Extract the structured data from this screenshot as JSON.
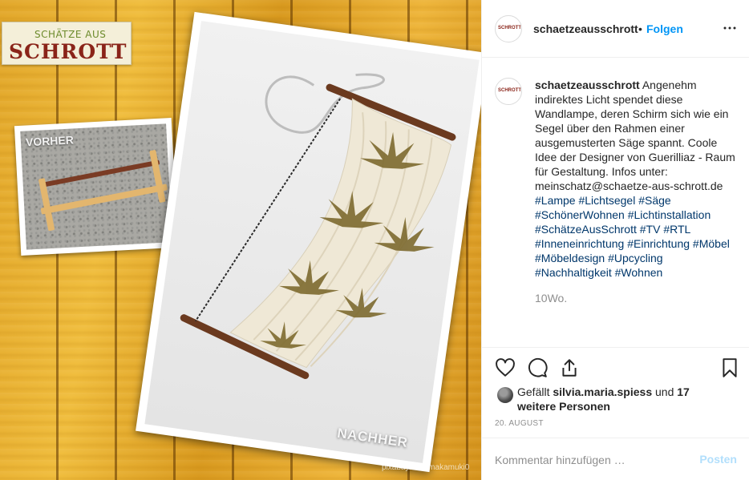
{
  "post_image": {
    "logo": {
      "line1": "SCHÄTZE AUS",
      "line2": "SCHROTT"
    },
    "before_label": "VORHER",
    "after_label": "NACHHER",
    "watermark": "pixabay.com makamuki0"
  },
  "header": {
    "username": "schaetzeausschrott",
    "separator": "•",
    "follow_label": "Folgen",
    "more_icon": "more-horizontal-icon"
  },
  "caption": {
    "username": "schaetzeausschrott",
    "text": "Angenehm indirektes Licht spendet diese Wandlampe, deren Schirm sich wie ein Segel über den Rahmen einer ausgemusterten Säge spannt. Coole Idee der Designer von Guerilliaz - Raum für Gestaltung. Infos unter: meinschatz@schaetze-aus-schrott.de",
    "hashtags": [
      "#Lampe",
      "#Lichtsegel",
      "#Säge",
      "#SchönerWohnen",
      "#Lichtinstallation",
      "#SchätzeAusSchrott",
      "#TV",
      "#RTL",
      "#Inneneinrichtung",
      "#Einrichtung",
      "#Möbel",
      "#Möbeldesign",
      "#Upcycling",
      "#Nachhaltigkeit",
      "#Wohnen"
    ],
    "age": "10Wo."
  },
  "actions": {
    "icons": [
      "heart-icon",
      "comment-icon",
      "share-icon",
      "bookmark-icon"
    ]
  },
  "likes": {
    "prefix": "Gefällt",
    "user": "silvia.maria.spiess",
    "connector": "und",
    "others": "17 weitere Personen"
  },
  "date": "20. AUGUST",
  "comment_box": {
    "placeholder": "Kommentar hinzufügen …",
    "post_label": "Posten"
  },
  "colors": {
    "link_blue": "#0095f6",
    "hashtag_blue": "#00376b",
    "muted_gray": "#8e8e8e",
    "post_button_disabled": "#b2dffc"
  }
}
